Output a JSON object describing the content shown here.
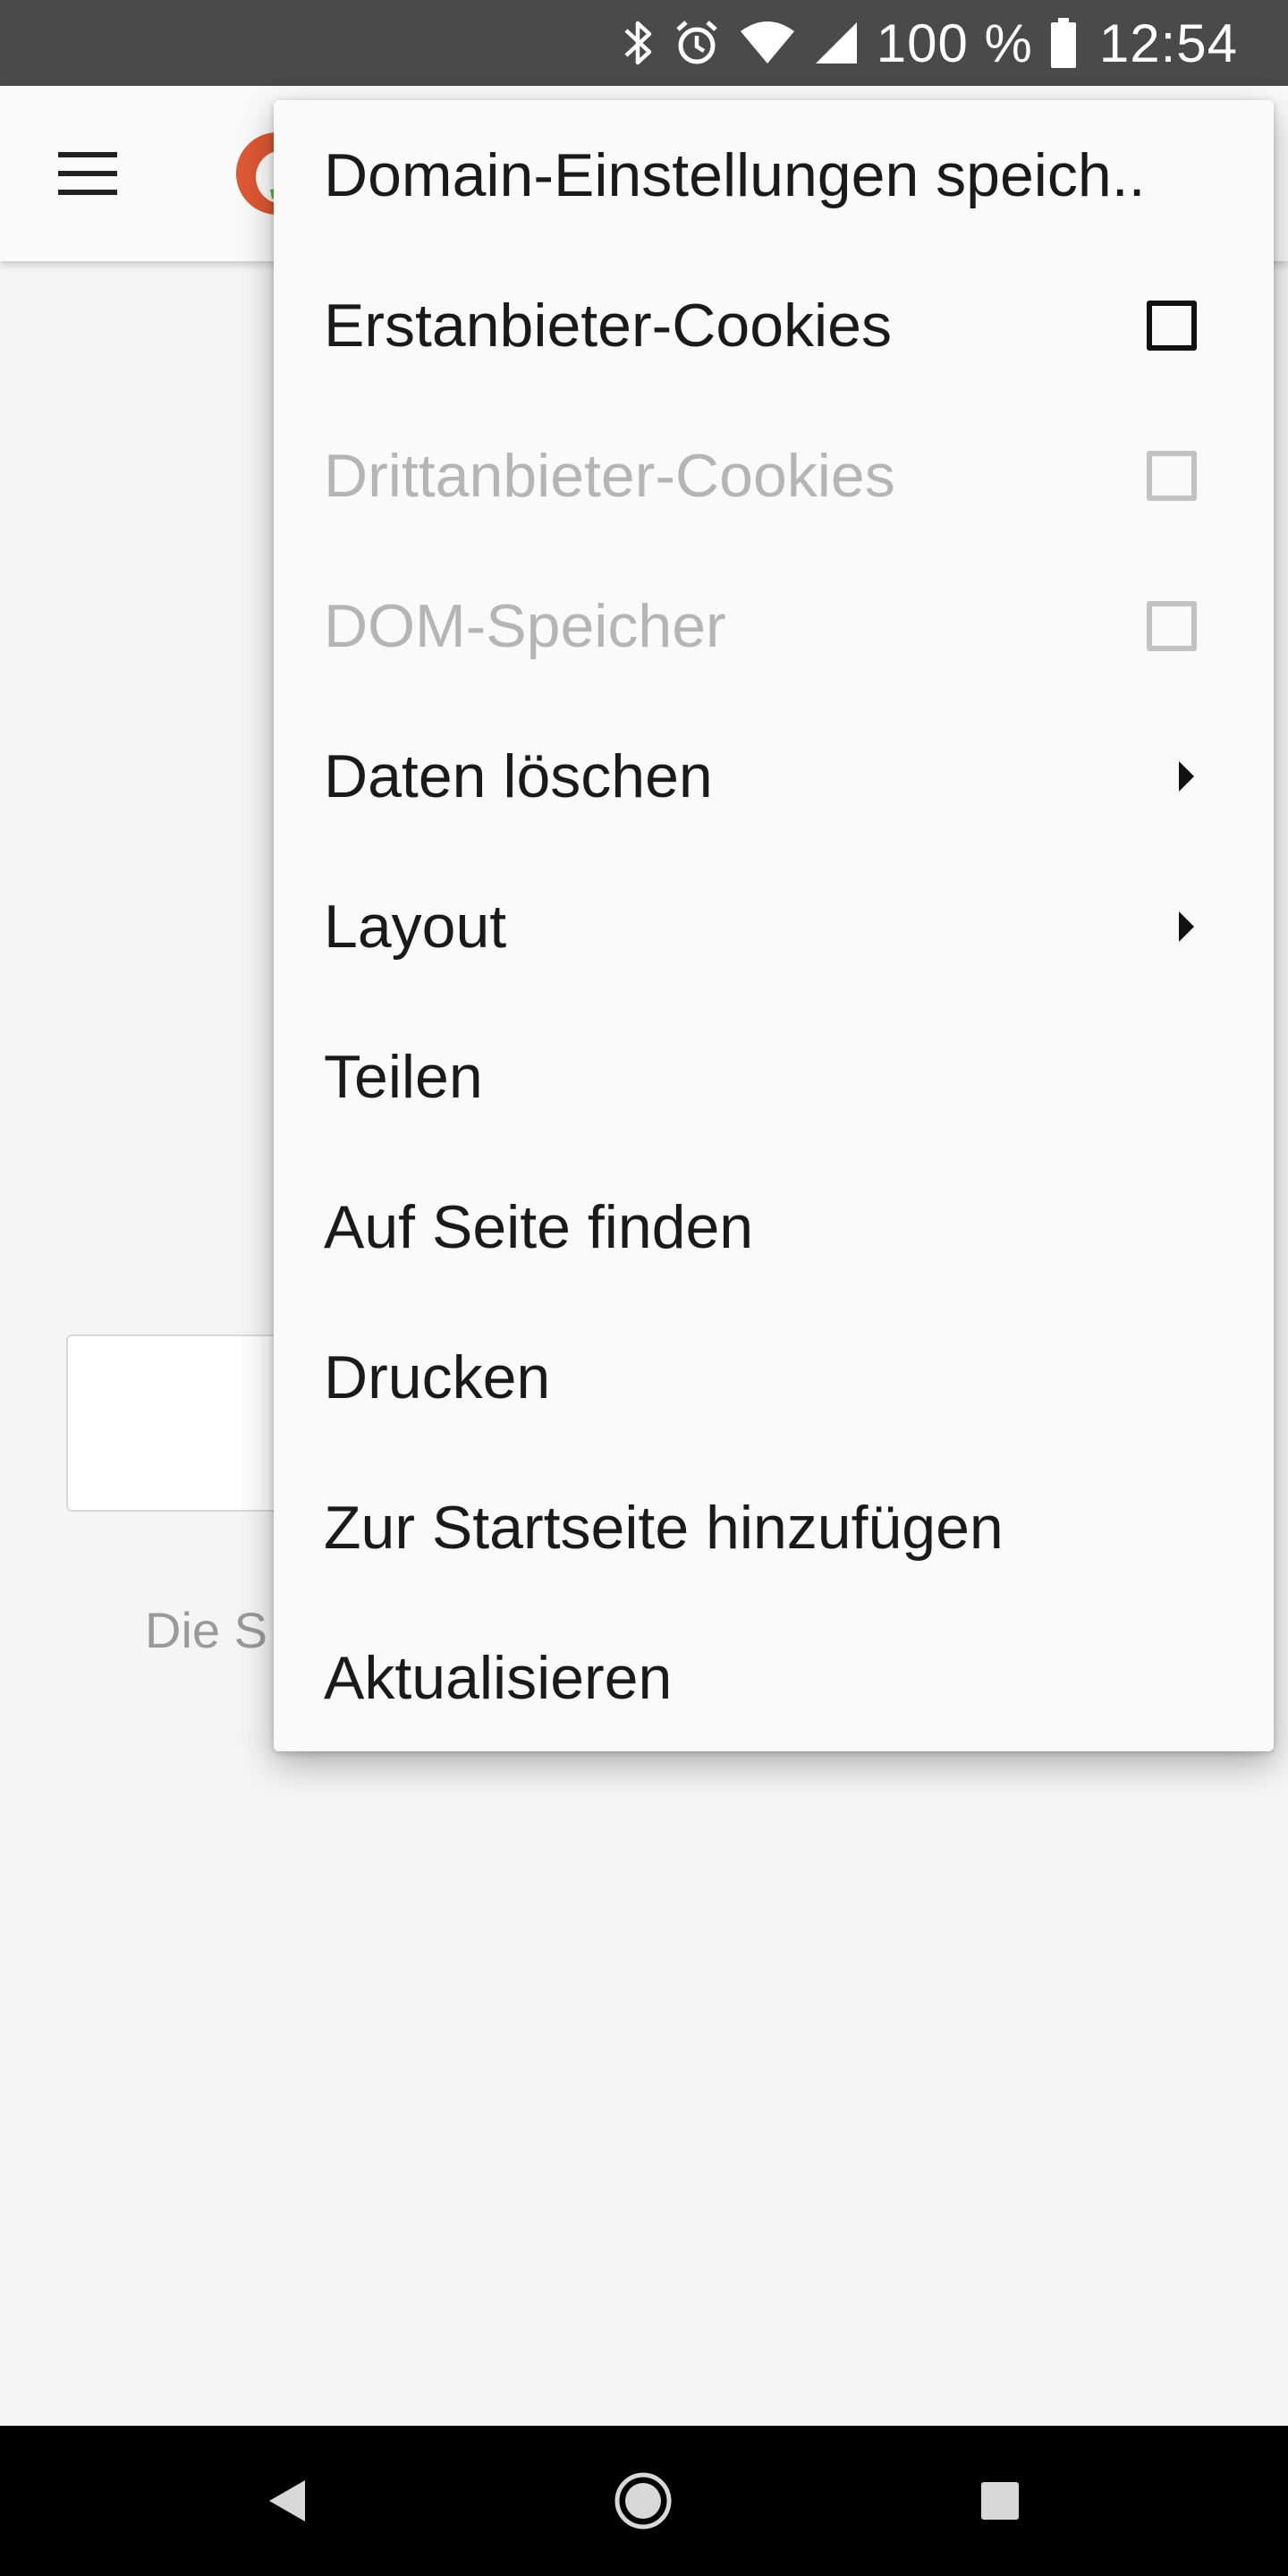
{
  "status_bar": {
    "icons": [
      "bluetooth-icon",
      "alarm-icon",
      "wifi-icon",
      "cell-signal-icon",
      "battery-icon"
    ],
    "battery": "100 %",
    "time": "12:54"
  },
  "toolbar": {
    "menu_icon": "hamburger-menu-icon",
    "logo_icon": "app-logo-icon"
  },
  "page": {
    "subtext": "Die S"
  },
  "popup_menu": {
    "items": [
      {
        "label": "Domain-Einstellungen speich..",
        "control": "none",
        "enabled": true
      },
      {
        "label": "Erstanbieter-Cookies",
        "control": "checkbox",
        "checked": false,
        "enabled": true
      },
      {
        "label": "Drittanbieter-Cookies",
        "control": "checkbox",
        "checked": false,
        "enabled": false
      },
      {
        "label": "DOM-Speicher",
        "control": "checkbox",
        "checked": false,
        "enabled": false
      },
      {
        "label": "Daten löschen",
        "control": "submenu",
        "enabled": true
      },
      {
        "label": "Layout",
        "control": "submenu",
        "enabled": true
      },
      {
        "label": "Teilen",
        "control": "none",
        "enabled": true
      },
      {
        "label": "Auf Seite finden",
        "control": "none",
        "enabled": true
      },
      {
        "label": "Drucken",
        "control": "none",
        "enabled": true
      },
      {
        "label": "Zur Startseite hinzufügen",
        "control": "none",
        "enabled": true
      },
      {
        "label": "Aktualisieren",
        "control": "none",
        "enabled": true
      }
    ]
  },
  "nav_bar": {
    "back_icon": "back-triangle-icon",
    "home_icon": "home-circle-icon",
    "recents_icon": "recents-square-icon"
  }
}
